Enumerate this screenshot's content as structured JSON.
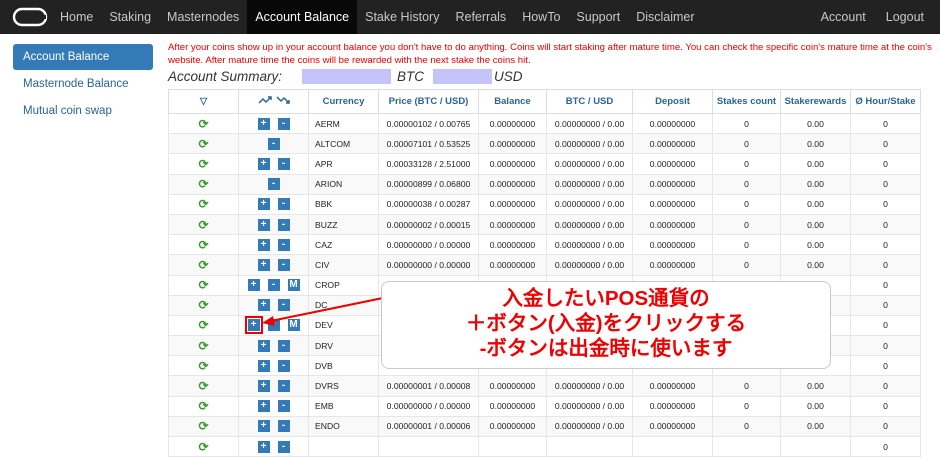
{
  "nav": {
    "logo": "logo-icon",
    "items": [
      "Home",
      "Staking",
      "Masternodes",
      "Account Balance",
      "Stake History",
      "Referrals",
      "HowTo",
      "Support",
      "Disclaimer"
    ],
    "active": "Account Balance",
    "right": [
      "Account",
      "Logout"
    ]
  },
  "sidebar": {
    "items": [
      "Account Balance",
      "Masternode Balance",
      "Mutual coin swap"
    ]
  },
  "notice": "After your coins show up in your account balance you don't have to do anything. Coins will start staking after mature time. You can check the specific coin's mature time at the coin's website. After mature time the coins will be rewarded with the next stake the coins hit.",
  "summary": {
    "label": "Account Summary:",
    "btc_unit": "BTC",
    "usd_unit": "USD"
  },
  "table": {
    "headers": [
      "▽",
      "",
      "Currency",
      "Price (BTC / USD)",
      "Balance",
      "BTC / USD",
      "Deposit",
      "Stakes count",
      "Stakerewards",
      "Ø Hour/Stake"
    ],
    "rows": [
      {
        "sym": "AERM",
        "btns": [
          "+",
          "-"
        ],
        "price": "0.00000102 / 0.00765",
        "balance": "0.00000000",
        "btcusd": "0.00000000 / 0.00",
        "deposit": "0.00000000",
        "count": "0",
        "rewards": "0.00",
        "hour": "0"
      },
      {
        "sym": "ALTCOM",
        "btns": [
          "-"
        ],
        "price": "0.00007101 / 0.53525",
        "balance": "0.00000000",
        "btcusd": "0.00000000 / 0.00",
        "deposit": "0.00000000",
        "count": "0",
        "rewards": "0.00",
        "hour": "0"
      },
      {
        "sym": "APR",
        "btns": [
          "+",
          "-"
        ],
        "price": "0.00033128 / 2.51000",
        "balance": "0.00000000",
        "btcusd": "0.00000000 / 0.00",
        "deposit": "0.00000000",
        "count": "0",
        "rewards": "0.00",
        "hour": "0"
      },
      {
        "sym": "ARION",
        "btns": [
          "-"
        ],
        "price": "0.00000899 / 0.06800",
        "balance": "0.00000000",
        "btcusd": "0.00000000 / 0.00",
        "deposit": "0.00000000",
        "count": "0",
        "rewards": "0.00",
        "hour": "0"
      },
      {
        "sym": "BBK",
        "btns": [
          "+",
          "-"
        ],
        "price": "0.00000038 / 0.00287",
        "balance": "0.00000000",
        "btcusd": "0.00000000 / 0.00",
        "deposit": "0.00000000",
        "count": "0",
        "rewards": "0.00",
        "hour": "0"
      },
      {
        "sym": "BUZZ",
        "btns": [
          "+",
          "-"
        ],
        "price": "0.00000002 / 0.00015",
        "balance": "0.00000000",
        "btcusd": "0.00000000 / 0.00",
        "deposit": "0.00000000",
        "count": "0",
        "rewards": "0.00",
        "hour": "0"
      },
      {
        "sym": "CAZ",
        "btns": [
          "+",
          "-"
        ],
        "price": "0.00000000 / 0.00000",
        "balance": "0.00000000",
        "btcusd": "0.00000000 / 0.00",
        "deposit": "0.00000000",
        "count": "0",
        "rewards": "0.00",
        "hour": "0"
      },
      {
        "sym": "CIV",
        "btns": [
          "+",
          "-"
        ],
        "price": "0.00000000 / 0.00000",
        "balance": "0.00000000",
        "btcusd": "0.00000000 / 0.00",
        "deposit": "0.00000000",
        "count": "0",
        "rewards": "0.00",
        "hour": "0"
      },
      {
        "sym": "CROP",
        "btns": [
          "+",
          "-",
          "M"
        ],
        "price": "",
        "balance": "",
        "btcusd": "",
        "deposit": "",
        "count": "",
        "rewards": "",
        "hour": "0"
      },
      {
        "sym": "DC",
        "btns": [
          "+",
          "-"
        ],
        "price": "",
        "balance": "",
        "btcusd": "",
        "deposit": "",
        "count": "",
        "rewards": "",
        "hour": "0"
      },
      {
        "sym": "DEV",
        "btns": [
          "+",
          "-",
          "M"
        ],
        "price": "",
        "balance": "",
        "btcusd": "",
        "deposit": "",
        "count": "",
        "rewards": "",
        "hour": "0",
        "highlight": true
      },
      {
        "sym": "DRV",
        "btns": [
          "+",
          "-"
        ],
        "price": "",
        "balance": "",
        "btcusd": "",
        "deposit": "",
        "count": "",
        "rewards": "",
        "hour": "0"
      },
      {
        "sym": "DVB",
        "btns": [
          "+",
          "-"
        ],
        "price": "",
        "balance": "",
        "btcusd": "",
        "deposit": "",
        "count": "",
        "rewards": "",
        "hour": "0"
      },
      {
        "sym": "DVRS",
        "btns": [
          "+",
          "-"
        ],
        "price": "0.00000001 / 0.00008",
        "balance": "0.00000000",
        "btcusd": "0.00000000 / 0.00",
        "deposit": "0.00000000",
        "count": "0",
        "rewards": "0.00",
        "hour": "0"
      },
      {
        "sym": "EMB",
        "btns": [
          "+",
          "-"
        ],
        "price": "0.00000000 / 0.00000",
        "balance": "0.00000000",
        "btcusd": "0.00000000 / 0.00",
        "deposit": "0.00000000",
        "count": "0",
        "rewards": "0.00",
        "hour": "0"
      },
      {
        "sym": "ENDO",
        "btns": [
          "+",
          "-"
        ],
        "price": "0.00000001 / 0.00006",
        "balance": "0.00000000",
        "btcusd": "0.00000000 / 0.00",
        "deposit": "0.00000000",
        "count": "0",
        "rewards": "0.00",
        "hour": "0"
      },
      {
        "sym": "",
        "btns": [
          "+",
          "-"
        ],
        "price": "",
        "balance": "",
        "btcusd": "",
        "deposit": "",
        "count": "",
        "rewards": "",
        "hour": "0"
      }
    ]
  },
  "callout": {
    "line1": "入金したいPOS通貨の",
    "line2": "＋ボタン(入金)をクリックする",
    "line3": "-ボタンは出金時に使います"
  },
  "colors": {
    "highlight": "#ee0000",
    "button": "#337ab7",
    "nav_bg": "#222222"
  }
}
